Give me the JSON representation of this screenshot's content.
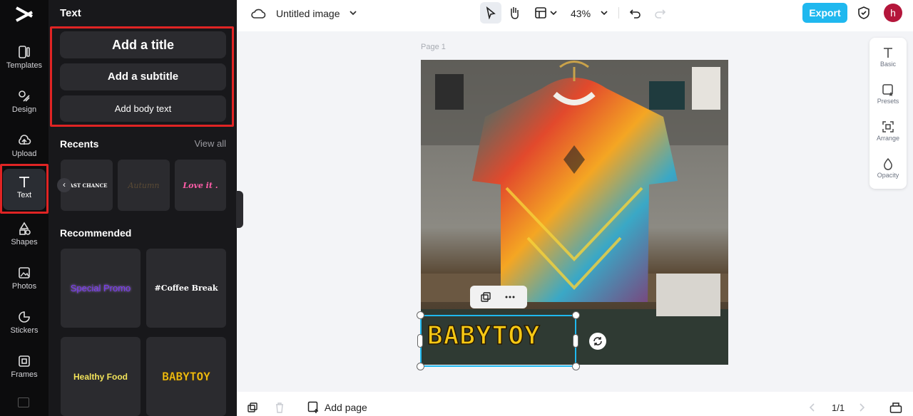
{
  "rail": {
    "items": [
      {
        "label": "Templates",
        "icon": "templates-icon"
      },
      {
        "label": "Design",
        "icon": "design-icon"
      },
      {
        "label": "Upload",
        "icon": "upload-icon"
      },
      {
        "label": "Text",
        "icon": "text-icon"
      },
      {
        "label": "Shapes",
        "icon": "shapes-icon"
      },
      {
        "label": "Photos",
        "icon": "photos-icon"
      },
      {
        "label": "Stickers",
        "icon": "stickers-icon"
      },
      {
        "label": "Frames",
        "icon": "frames-icon"
      }
    ]
  },
  "panel": {
    "title": "Text",
    "add_title": "Add a title",
    "add_subtitle": "Add a subtitle",
    "add_body": "Add body text",
    "recents_title": "Recents",
    "view_all": "View all",
    "recents": [
      "LAST CHANCE",
      "Autumn",
      "Love it ."
    ],
    "recommended_title": "Recommended",
    "recommended": [
      "Special Promo",
      "#Coffee Break",
      "Healthy Food",
      "BABYTOY"
    ]
  },
  "topbar": {
    "doc_title": "Untitled image",
    "zoom": "43%",
    "export": "Export",
    "avatar_initial": "h"
  },
  "canvas": {
    "page_label": "Page 1",
    "text_element": "BABYTOY"
  },
  "tools": [
    {
      "label": "Basic",
      "icon": "text-basic-icon"
    },
    {
      "label": "Presets",
      "icon": "presets-icon"
    },
    {
      "label": "Arrange",
      "icon": "arrange-icon"
    },
    {
      "label": "Opacity",
      "icon": "opacity-icon"
    }
  ],
  "bottombar": {
    "add_page": "Add page",
    "page_counter": "1/1"
  },
  "colors": {
    "accent": "#1fb8ef",
    "highlight": "#e02424",
    "panel_bg": "#18181b"
  }
}
